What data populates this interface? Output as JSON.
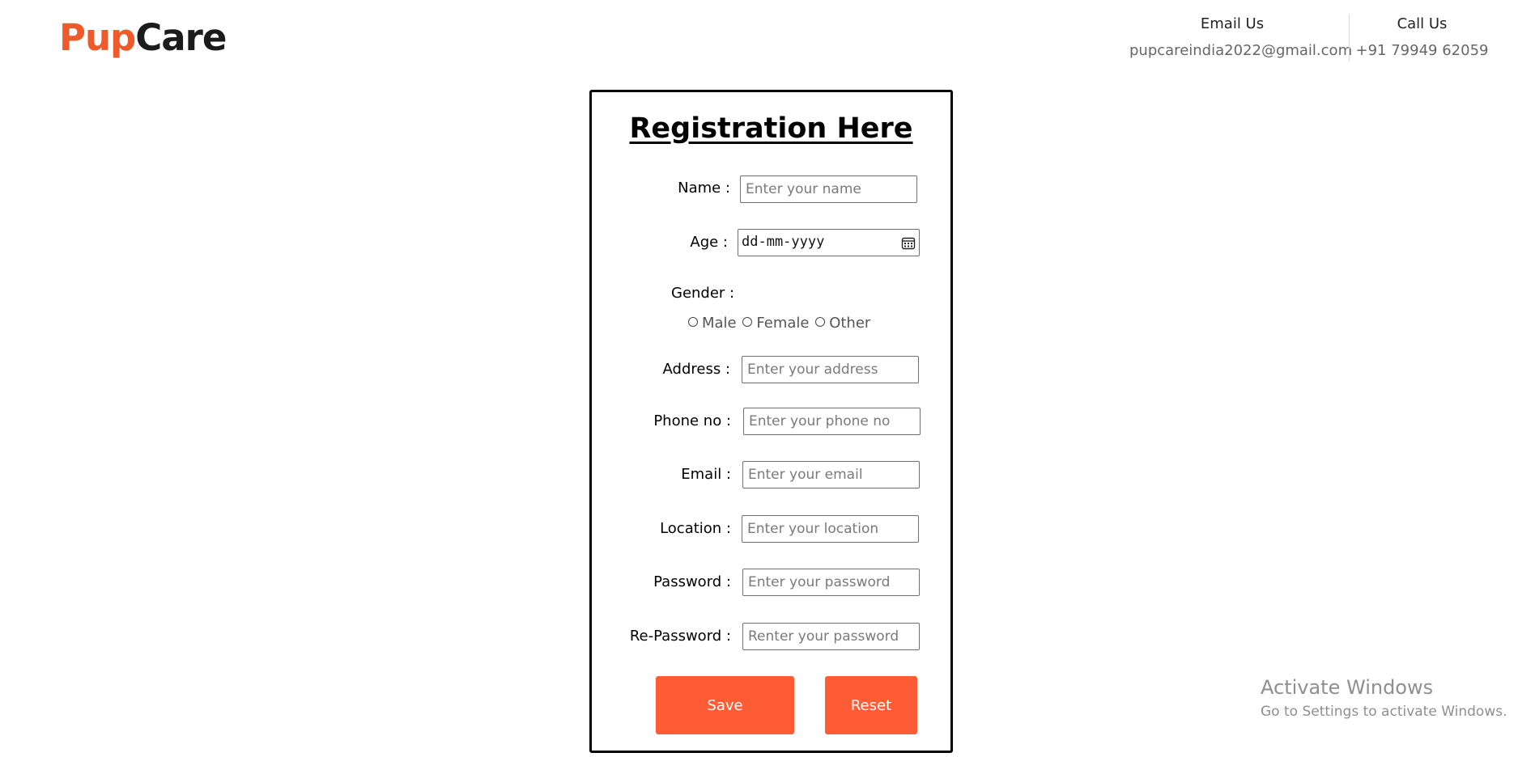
{
  "brand": {
    "part1": "Pup",
    "part2": "Care",
    "part1_color": "#ef5a2b",
    "part2_color": "#1b1b1b"
  },
  "contact": {
    "email_title": "Email Us",
    "email_value": "pupcareindia2022@gmail.com",
    "call_title": "Call Us",
    "call_value": "+91 79949 62059"
  },
  "form": {
    "title": "Registration Here",
    "name_label": "Name :",
    "name_placeholder": "Enter your name",
    "age_label": "Age :",
    "age_value": "dd-mm-yyyy",
    "gender_label": "Gender :",
    "gender_options": [
      "Male",
      "Female",
      "Other"
    ],
    "address_label": "Address :",
    "address_placeholder": "Enter your address",
    "phone_label": "Phone no :",
    "phone_placeholder": "Enter your phone no",
    "email_label": "Email :",
    "email_placeholder": "Enter your email",
    "location_label": "Location :",
    "location_placeholder": "Enter your location",
    "password_label": "Password :",
    "password_placeholder": "Enter your password",
    "repassword_label": "Re-Password :",
    "repassword_placeholder": "Renter your password",
    "save_label": "Save",
    "reset_label": "Reset",
    "button_color": "#ff5c35"
  },
  "watermark": {
    "title": "Activate Windows",
    "subtitle": "Go to Settings to activate Windows."
  }
}
